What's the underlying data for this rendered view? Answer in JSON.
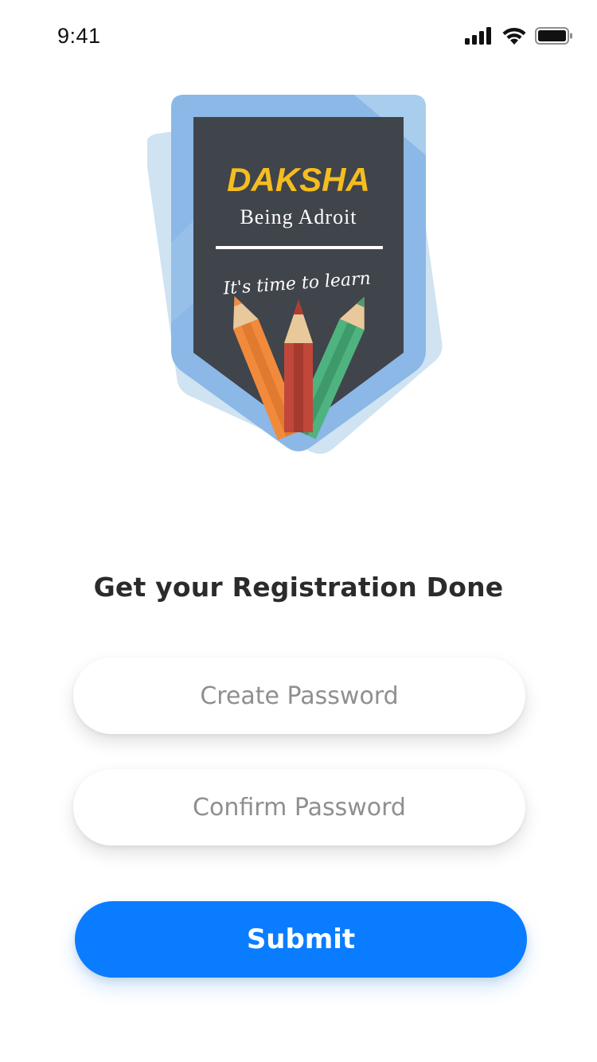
{
  "status_bar": {
    "time": "9:41",
    "icons": [
      "cellular-signal-icon",
      "wifi-icon",
      "battery-icon"
    ]
  },
  "logo": {
    "brand": "DAKSHA",
    "tagline": "Being Adroit",
    "slogan": "It's time to learn",
    "colors": {
      "shield_outer": "#8bb8e6",
      "shield_back": "#cfe3f2",
      "board": "#40444b",
      "brand_text": "#f5bd1f"
    }
  },
  "form": {
    "heading": "Get your Registration Done",
    "create_password_placeholder": "Create Password",
    "confirm_password_placeholder": "Confirm Password",
    "submit_label": "Submit"
  },
  "colors": {
    "accent": "#0a7cff",
    "heading_text": "#2b2b2b",
    "placeholder_text": "#8f8f8f"
  }
}
